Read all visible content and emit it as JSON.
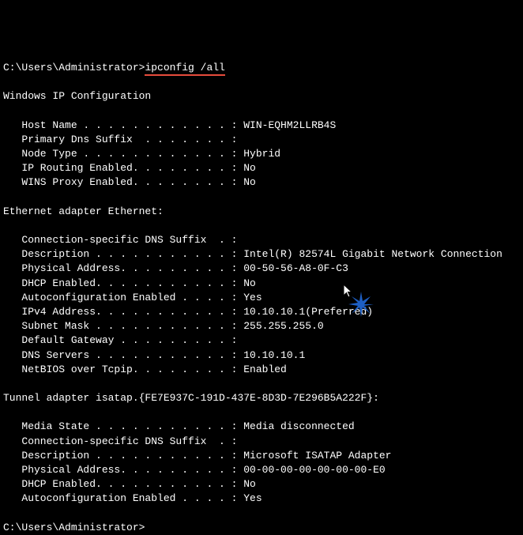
{
  "prompt1": {
    "path": "C:\\Users\\Administrator>",
    "command": "ipconfig /all"
  },
  "section1_title": "Windows IP Configuration",
  "section1": {
    "host_name_label": "   Host Name . . . . . . . . . . . . : ",
    "host_name_value": "WIN-EQHM2LLRB4S",
    "primary_dns_label": "   Primary Dns Suffix  . . . . . . . :",
    "node_type_label": "   Node Type . . . . . . . . . . . . : ",
    "node_type_value": "Hybrid",
    "ip_routing_label": "   IP Routing Enabled. . . . . . . . : ",
    "ip_routing_value": "No",
    "wins_proxy_label": "   WINS Proxy Enabled. . . . . . . . : ",
    "wins_proxy_value": "No"
  },
  "section2_title": "Ethernet adapter Ethernet:",
  "section2": {
    "conn_suffix_label": "   Connection-specific DNS Suffix  . :",
    "description_label": "   Description . . . . . . . . . . . : ",
    "description_value": "Intel(R) 82574L Gigabit Network Connection",
    "physical_label": "   Physical Address. . . . . . . . . : ",
    "physical_value": "00-50-56-A8-0F-C3",
    "dhcp_label": "   DHCP Enabled. . . . . . . . . . . : ",
    "dhcp_value": "No",
    "autoconfig_label": "   Autoconfiguration Enabled . . . . : ",
    "autoconfig_value": "Yes",
    "ipv4_label": "   IPv4 Address. . . . . . . . . . . : ",
    "ipv4_value": "10.10.10.1(Preferred)",
    "subnet_label": "   Subnet Mask . . . . . . . . . . . : ",
    "subnet_value": "255.255.255.0",
    "gateway_label": "   Default Gateway . . . . . . . . . :",
    "dns_label": "   DNS Servers . . . . . . . . . . . : ",
    "dns_value": "10.10.10.1",
    "netbios_label": "   NetBIOS over Tcpip. . . . . . . . : ",
    "netbios_value": "Enabled"
  },
  "section3_title": "Tunnel adapter isatap.{FE7E937C-191D-437E-8D3D-7E296B5A222F}:",
  "section3": {
    "media_state_label": "   Media State . . . . . . . . . . . : ",
    "media_state_value": "Media disconnected",
    "conn_suffix_label": "   Connection-specific DNS Suffix  . :",
    "description_label": "   Description . . . . . . . . . . . : ",
    "description_value": "Microsoft ISATAP Adapter",
    "physical_label": "   Physical Address. . . . . . . . . : ",
    "physical_value": "00-00-00-00-00-00-00-E0",
    "dhcp_label": "   DHCP Enabled. . . . . . . . . . . : ",
    "dhcp_value": "No",
    "autoconfig_label": "   Autoconfiguration Enabled . . . . : ",
    "autoconfig_value": "Yes"
  },
  "prompt2": {
    "path": "C:\\Users\\Administrator>"
  }
}
